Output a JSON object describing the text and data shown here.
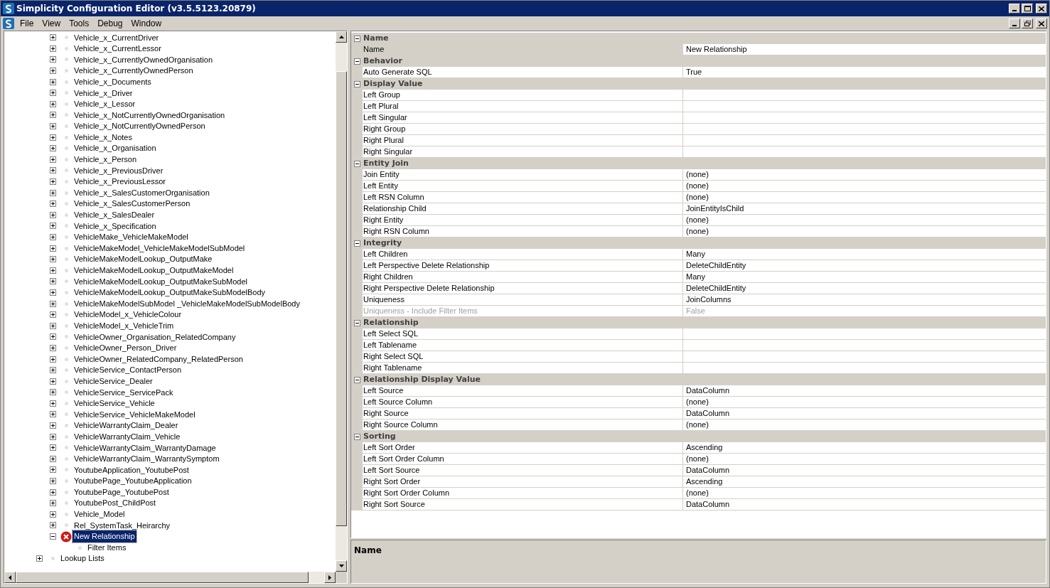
{
  "window": {
    "title": "Simplicity Configuration Editor (v3.5.5123.20879)"
  },
  "menu": [
    "File",
    "View",
    "Tools",
    "Debug",
    "Window"
  ],
  "tree": {
    "items": [
      {
        "label": "Vehicle_x_CurrentDriver",
        "expanded": false,
        "selected": false,
        "kind": "node"
      },
      {
        "label": "Vehicle_x_CurrentLessor",
        "expanded": false,
        "selected": false,
        "kind": "node"
      },
      {
        "label": "Vehicle_x_CurrentlyOwnedOrganisation",
        "expanded": false,
        "selected": false,
        "kind": "node"
      },
      {
        "label": "Vehicle_x_CurrentlyOwnedPerson",
        "expanded": false,
        "selected": false,
        "kind": "node"
      },
      {
        "label": "Vehicle_x_Documents",
        "expanded": false,
        "selected": false,
        "kind": "node"
      },
      {
        "label": "Vehicle_x_Driver",
        "expanded": false,
        "selected": false,
        "kind": "node"
      },
      {
        "label": "Vehicle_x_Lessor",
        "expanded": false,
        "selected": false,
        "kind": "node"
      },
      {
        "label": "Vehicle_x_NotCurrentlyOwnedOrganisation",
        "expanded": false,
        "selected": false,
        "kind": "node"
      },
      {
        "label": "Vehicle_x_NotCurrentlyOwnedPerson",
        "expanded": false,
        "selected": false,
        "kind": "node"
      },
      {
        "label": "Vehicle_x_Notes",
        "expanded": false,
        "selected": false,
        "kind": "node"
      },
      {
        "label": "Vehicle_x_Organisation",
        "expanded": false,
        "selected": false,
        "kind": "node"
      },
      {
        "label": "Vehicle_x_Person",
        "expanded": false,
        "selected": false,
        "kind": "node"
      },
      {
        "label": "Vehicle_x_PreviousDriver",
        "expanded": false,
        "selected": false,
        "kind": "node"
      },
      {
        "label": "Vehicle_x_PreviousLessor",
        "expanded": false,
        "selected": false,
        "kind": "node"
      },
      {
        "label": "Vehicle_x_SalesCustomerOrganisation",
        "expanded": false,
        "selected": false,
        "kind": "node"
      },
      {
        "label": "Vehicle_x_SalesCustomerPerson",
        "expanded": false,
        "selected": false,
        "kind": "node"
      },
      {
        "label": "Vehicle_x_SalesDealer",
        "expanded": false,
        "selected": false,
        "kind": "node"
      },
      {
        "label": "Vehicle_x_Specification",
        "expanded": false,
        "selected": false,
        "kind": "node"
      },
      {
        "label": "VehicleMake_VehicleMakeModel",
        "expanded": false,
        "selected": false,
        "kind": "node"
      },
      {
        "label": "VehicleMakeModel_VehicleMakeModelSubModel",
        "expanded": false,
        "selected": false,
        "kind": "node"
      },
      {
        "label": "VehicleMakeModelLookup_OutputMake",
        "expanded": false,
        "selected": false,
        "kind": "node"
      },
      {
        "label": "VehicleMakeModelLookup_OutputMakeModel",
        "expanded": false,
        "selected": false,
        "kind": "node"
      },
      {
        "label": "VehicleMakeModelLookup_OutputMakeSubModel",
        "expanded": false,
        "selected": false,
        "kind": "node"
      },
      {
        "label": "VehicleMakeModelLookup_OutputMakeSubModelBody",
        "expanded": false,
        "selected": false,
        "kind": "node"
      },
      {
        "label": "VehicleMakeModelSubModel _VehicleMakeModelSubModelBody",
        "expanded": false,
        "selected": false,
        "kind": "node"
      },
      {
        "label": "VehicleModel_x_VehicleColour",
        "expanded": false,
        "selected": false,
        "kind": "node"
      },
      {
        "label": "VehicleModel_x_VehicleTrim",
        "expanded": false,
        "selected": false,
        "kind": "node"
      },
      {
        "label": "VehicleOwner_Organisation_RelatedCompany",
        "expanded": false,
        "selected": false,
        "kind": "node"
      },
      {
        "label": "VehicleOwner_Person_Driver",
        "expanded": false,
        "selected": false,
        "kind": "node"
      },
      {
        "label": "VehicleOwner_RelatedCompany_RelatedPerson",
        "expanded": false,
        "selected": false,
        "kind": "node"
      },
      {
        "label": "VehicleService_ContactPerson",
        "expanded": false,
        "selected": false,
        "kind": "node"
      },
      {
        "label": "VehicleService_Dealer",
        "expanded": false,
        "selected": false,
        "kind": "node"
      },
      {
        "label": "VehicleService_ServicePack",
        "expanded": false,
        "selected": false,
        "kind": "node"
      },
      {
        "label": "VehicleService_Vehicle",
        "expanded": false,
        "selected": false,
        "kind": "node"
      },
      {
        "label": "VehicleService_VehicleMakeModel",
        "expanded": false,
        "selected": false,
        "kind": "node"
      },
      {
        "label": "VehicleWarrantyClaim_Dealer",
        "expanded": false,
        "selected": false,
        "kind": "node"
      },
      {
        "label": "VehicleWarrantyClaim_Vehicle",
        "expanded": false,
        "selected": false,
        "kind": "node"
      },
      {
        "label": "VehicleWarrantyClaim_WarrantyDamage",
        "expanded": false,
        "selected": false,
        "kind": "node"
      },
      {
        "label": "VehicleWarrantyClaim_WarrantySymptom",
        "expanded": false,
        "selected": false,
        "kind": "node"
      },
      {
        "label": "YoutubeApplication_YoutubePost",
        "expanded": false,
        "selected": false,
        "kind": "node"
      },
      {
        "label": "YoutubePage_YoutubeApplication",
        "expanded": false,
        "selected": false,
        "kind": "node"
      },
      {
        "label": "YoutubePage_YoutubePost",
        "expanded": false,
        "selected": false,
        "kind": "node"
      },
      {
        "label": "YoutubePost_ChildPost",
        "expanded": false,
        "selected": false,
        "kind": "node"
      },
      {
        "label": "Vehicle_Model",
        "expanded": false,
        "selected": false,
        "kind": "node"
      },
      {
        "label": "Rel_SystemTask_Heirarchy",
        "expanded": false,
        "selected": false,
        "kind": "node"
      },
      {
        "label": "New Relationship",
        "expanded": true,
        "selected": true,
        "kind": "error",
        "children": [
          {
            "label": "Filter Items",
            "selected": false,
            "kind": "leaf"
          }
        ]
      }
    ],
    "outer_items": [
      {
        "label": "Lookup Lists",
        "expanded": false,
        "selected": false,
        "kind": "node"
      }
    ]
  },
  "properties": [
    {
      "category": "Name",
      "expanded": true,
      "rows": [
        {
          "name": "Name",
          "value": "New Relationship",
          "selected": true,
          "disabled": false
        }
      ]
    },
    {
      "category": "Behavior",
      "expanded": true,
      "rows": [
        {
          "name": "Auto Generate SQL",
          "value": "True",
          "selected": false,
          "disabled": false
        }
      ]
    },
    {
      "category": "Display Value",
      "expanded": true,
      "rows": [
        {
          "name": "Left Group",
          "selected": false,
          "disabled": false
        },
        {
          "name": "Left Plural",
          "selected": false,
          "disabled": false
        },
        {
          "name": "Left Singular",
          "selected": false,
          "disabled": false
        },
        {
          "name": "Right Group",
          "selected": false,
          "disabled": false
        },
        {
          "name": "Right Plural",
          "selected": false,
          "disabled": false
        },
        {
          "name": "Right Singular",
          "selected": false,
          "disabled": false
        }
      ]
    },
    {
      "category": "Entity Join",
      "expanded": true,
      "rows": [
        {
          "name": "Join Entity",
          "value": "(none)",
          "selected": false,
          "disabled": false
        },
        {
          "name": "Left Entity",
          "value": "(none)",
          "selected": false,
          "disabled": false
        },
        {
          "name": "Left RSN Column",
          "value": "(none)",
          "selected": false,
          "disabled": false
        },
        {
          "name": "Relationship Child",
          "value": "JoinEntityIsChild",
          "selected": false,
          "disabled": false
        },
        {
          "name": "Right Entity",
          "value": "(none)",
          "selected": false,
          "disabled": false
        },
        {
          "name": "Right RSN Column",
          "value": "(none)",
          "selected": false,
          "disabled": false
        }
      ]
    },
    {
      "category": "Integrity",
      "expanded": true,
      "rows": [
        {
          "name": "Left Children",
          "value": "Many",
          "selected": false,
          "disabled": false
        },
        {
          "name": "Left Perspective Delete Relationship",
          "value": "DeleteChildEntity",
          "selected": false,
          "disabled": false
        },
        {
          "name": "Right Children",
          "value": "Many",
          "selected": false,
          "disabled": false
        },
        {
          "name": "Right Perspective Delete Relationship",
          "value": "DeleteChildEntity",
          "selected": false,
          "disabled": false
        },
        {
          "name": "Uniqueness",
          "value": "JoinColumns",
          "selected": false,
          "disabled": false
        },
        {
          "name": "Uniqueness - Include Filter Items",
          "value": "False",
          "selected": false,
          "disabled": true
        }
      ]
    },
    {
      "category": "Relationship",
      "expanded": true,
      "rows": [
        {
          "name": "Left Select SQL",
          "selected": false,
          "disabled": false
        },
        {
          "name": "Left Tablename",
          "selected": false,
          "disabled": false
        },
        {
          "name": "Right Select SQL",
          "selected": false,
          "disabled": false
        },
        {
          "name": "Right Tablename",
          "selected": false,
          "disabled": false
        }
      ]
    },
    {
      "category": "Relationship Display Value",
      "expanded": true,
      "rows": [
        {
          "name": "Left Source",
          "value": "DataColumn",
          "selected": false,
          "disabled": false
        },
        {
          "name": "Left Source Column",
          "value": "(none)",
          "selected": false,
          "disabled": false
        },
        {
          "name": "Right Source",
          "value": "DataColumn",
          "selected": false,
          "disabled": false
        },
        {
          "name": "Right Source Column",
          "value": "(none)",
          "selected": false,
          "disabled": false
        }
      ]
    },
    {
      "category": "Sorting",
      "expanded": true,
      "rows": [
        {
          "name": "Left Sort Order",
          "value": "Ascending",
          "selected": false,
          "disabled": false
        },
        {
          "name": "Left Sort Order Column",
          "value": "(none)",
          "selected": false,
          "disabled": false
        },
        {
          "name": "Left Sort Source",
          "value": "DataColumn",
          "selected": false,
          "disabled": false
        },
        {
          "name": "Right Sort Order",
          "value": "Ascending",
          "selected": false,
          "disabled": false
        },
        {
          "name": "Right Sort Order Column",
          "value": "(none)",
          "selected": false,
          "disabled": false
        },
        {
          "name": "Right Sort Source",
          "value": "DataColumn",
          "selected": false,
          "disabled": false
        }
      ]
    }
  ],
  "description": {
    "title": "Name"
  }
}
